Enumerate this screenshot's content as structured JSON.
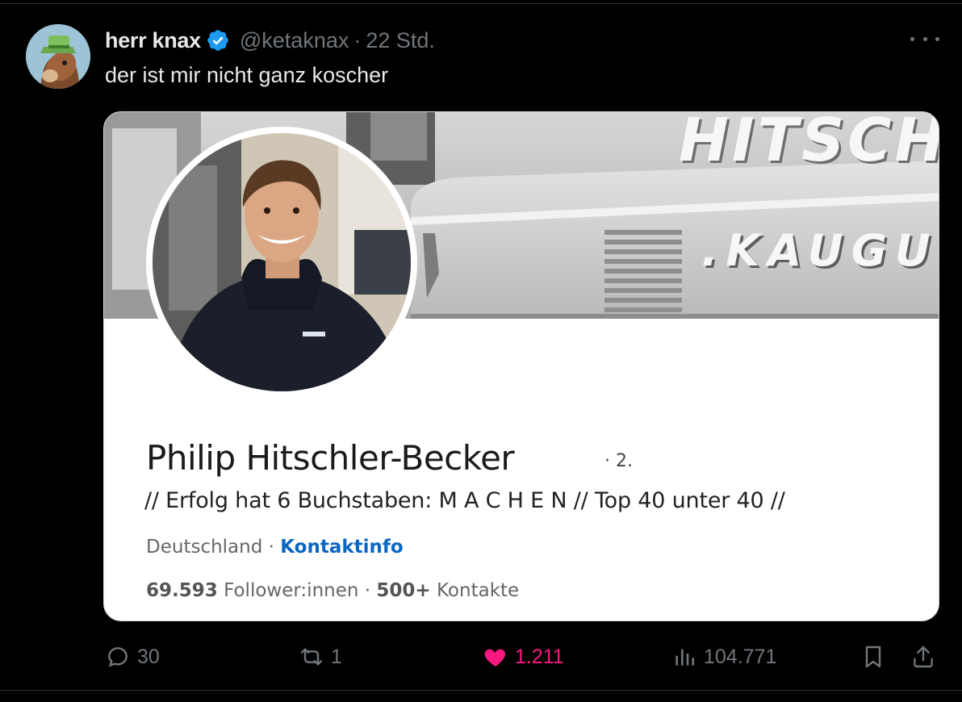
{
  "tweet": {
    "author": {
      "display_name": "herr knax",
      "handle": "@ketaknax",
      "verified": true
    },
    "separator": "·",
    "time": "22 Std.",
    "text": "der ist mir nicht ganz koscher"
  },
  "card": {
    "banner_text_top": "HITSCH",
    "banner_text_bottom": ".KAUGU",
    "name": "Philip Hitschler-Becker",
    "degree": "· 2.",
    "headline": "// Erfolg hat 6 Buchstaben: M A C H E N // Top 40 unter 40 //",
    "location": "Deutschland",
    "meta_sep": " · ",
    "contact_link": "Kontaktinfo",
    "followers_count": "69.593",
    "followers_label": "Follower:innen",
    "stats_sep": " · ",
    "contacts_count": "500+",
    "contacts_label": "Kontakte"
  },
  "actions": {
    "replies": "30",
    "retweets": "1",
    "likes": "1.211",
    "views": "104.771"
  },
  "colors": {
    "background": "#000000",
    "text": "#e7e9ea",
    "muted": "#71767b",
    "like": "#f91880",
    "verified": "#1d9bf0",
    "linkedin_link": "#0a66c2"
  }
}
